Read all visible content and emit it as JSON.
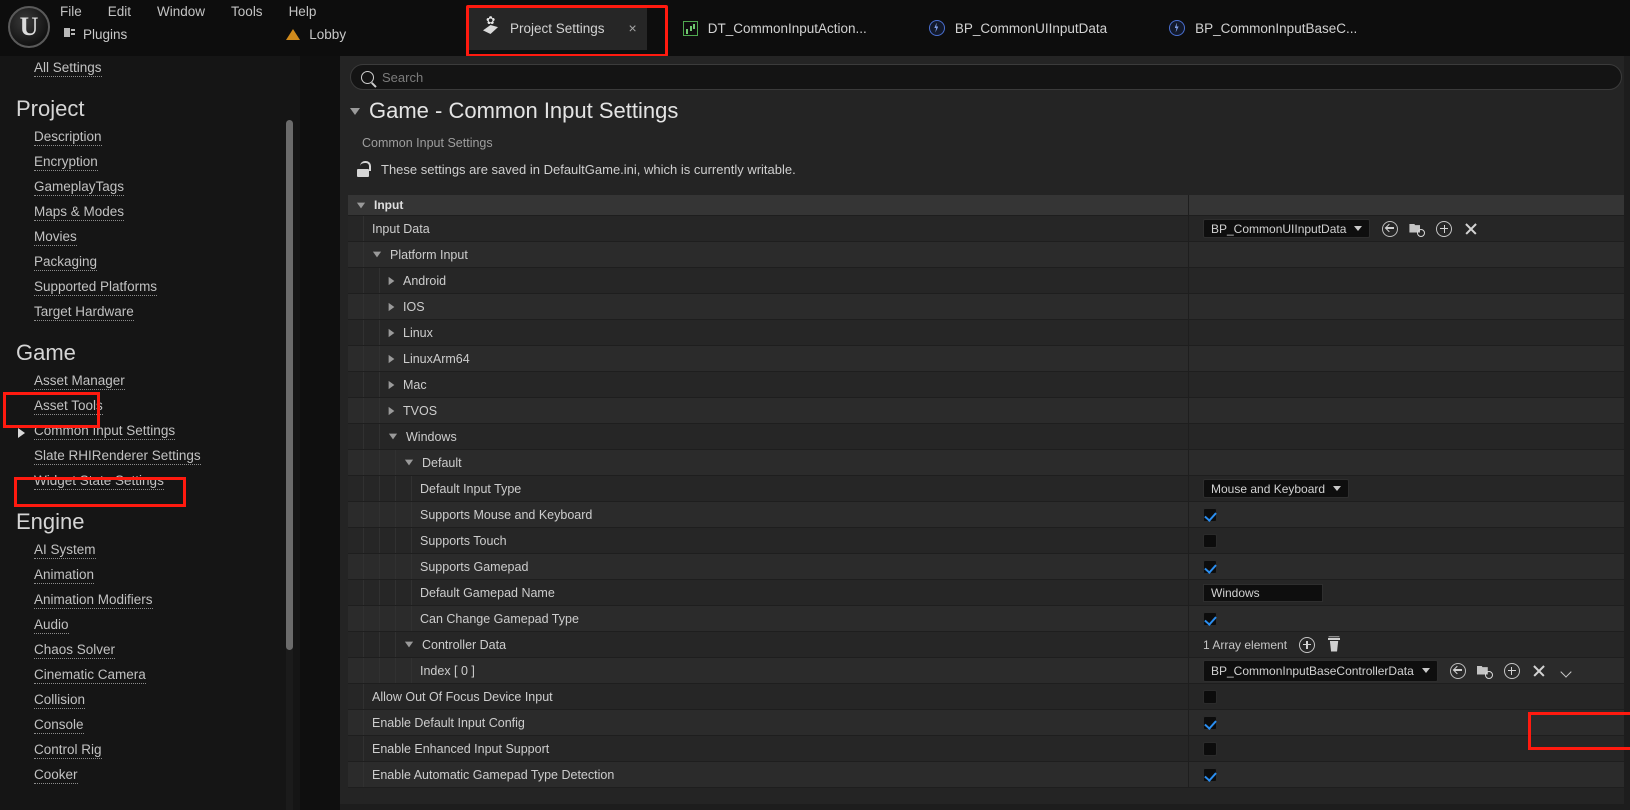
{
  "app": {
    "logo_glyph": "U",
    "menu": [
      "File",
      "Edit",
      "Window",
      "Tools",
      "Help"
    ],
    "toolbar": [
      {
        "label": "Plugins",
        "icon": "plugin-icon"
      },
      {
        "label": "Lobby",
        "icon": "level-icon"
      }
    ]
  },
  "tabs": [
    {
      "label": "Project Settings",
      "icon": "project-settings-icon",
      "active": true,
      "close": "×"
    },
    {
      "label": "DT_CommonInputAction...",
      "icon": "data-table-icon",
      "active": false
    },
    {
      "label": "BP_CommonUIInputData",
      "icon": "blueprint-icon",
      "active": false
    },
    {
      "label": "BP_CommonInputBaseC...",
      "icon": "blueprint-icon",
      "active": false
    }
  ],
  "sidebar": {
    "top_item": "All Settings",
    "sections": [
      {
        "heading": "Project",
        "items": [
          {
            "label": "Description"
          },
          {
            "label": "Encryption"
          },
          {
            "label": "GameplayTags"
          },
          {
            "label": "Maps & Modes"
          },
          {
            "label": "Movies"
          },
          {
            "label": "Packaging"
          },
          {
            "label": "Supported Platforms"
          },
          {
            "label": "Target Hardware"
          }
        ]
      },
      {
        "heading": "Game",
        "items": [
          {
            "label": "Asset Manager"
          },
          {
            "label": "Asset Tools"
          },
          {
            "label": "Common Input Settings",
            "expandable": true,
            "selected": true
          },
          {
            "label": "Slate RHIRenderer Settings"
          },
          {
            "label": "Widget State Settings"
          }
        ]
      },
      {
        "heading": "Engine",
        "items": [
          {
            "label": "AI System"
          },
          {
            "label": "Animation"
          },
          {
            "label": "Animation Modifiers"
          },
          {
            "label": "Audio"
          },
          {
            "label": "Chaos Solver"
          },
          {
            "label": "Cinematic Camera"
          },
          {
            "label": "Collision"
          },
          {
            "label": "Console"
          },
          {
            "label": "Control Rig"
          },
          {
            "label": "Cooker"
          }
        ]
      }
    ]
  },
  "main": {
    "search_placeholder": "Search",
    "search_value": "",
    "page_title": "Game - Common Input Settings",
    "subtitle": "Common Input Settings",
    "lock_note": "These settings are saved in DefaultGame.ini, which is currently writable.",
    "rows": [
      {
        "kind": "category",
        "name": "Input",
        "depth": 0,
        "expanded": true
      },
      {
        "kind": "object",
        "name": "Input Data",
        "depth": 1,
        "value": "BP_CommonUIInputData",
        "actions": [
          "use-selected-icon",
          "browse-icon",
          "new-asset-icon",
          "clear-icon"
        ]
      },
      {
        "kind": "group",
        "name": "Platform Input",
        "depth": 1,
        "expanded": true
      },
      {
        "kind": "group",
        "name": "Android",
        "depth": 2,
        "expanded": false
      },
      {
        "kind": "group",
        "name": "IOS",
        "depth": 2,
        "expanded": false
      },
      {
        "kind": "group",
        "name": "Linux",
        "depth": 2,
        "expanded": false
      },
      {
        "kind": "group",
        "name": "LinuxArm64",
        "depth": 2,
        "expanded": false
      },
      {
        "kind": "group",
        "name": "Mac",
        "depth": 2,
        "expanded": false
      },
      {
        "kind": "group",
        "name": "TVOS",
        "depth": 2,
        "expanded": false
      },
      {
        "kind": "group",
        "name": "Windows",
        "depth": 2,
        "expanded": true
      },
      {
        "kind": "group",
        "name": "Default",
        "depth": 3,
        "expanded": true
      },
      {
        "kind": "enum",
        "name": "Default Input Type",
        "depth": 4,
        "value": "Mouse and Keyboard"
      },
      {
        "kind": "bool",
        "name": "Supports Mouse and Keyboard",
        "depth": 4,
        "value": true
      },
      {
        "kind": "bool",
        "name": "Supports Touch",
        "depth": 4,
        "value": false
      },
      {
        "kind": "bool",
        "name": "Supports Gamepad",
        "depth": 4,
        "value": true
      },
      {
        "kind": "text",
        "name": "Default Gamepad Name",
        "depth": 4,
        "value": "Windows"
      },
      {
        "kind": "bool",
        "name": "Can Change Gamepad Type",
        "depth": 4,
        "value": true
      },
      {
        "kind": "array",
        "name": "Controller Data",
        "depth": 3,
        "expanded": true,
        "value": "1 Array element",
        "actions": [
          "add-element-icon",
          "delete-all-icon"
        ]
      },
      {
        "kind": "object",
        "name": "Index [ 0 ]",
        "depth": 4,
        "value": "BP_CommonInputBaseControllerData",
        "highlighted": true,
        "actions": [
          "use-selected-icon",
          "browse-icon",
          "new-asset-icon",
          "clear-icon",
          "chevron-down-icon"
        ]
      },
      {
        "kind": "bool",
        "name": "Allow Out Of Focus Device Input",
        "depth": 1,
        "value": false
      },
      {
        "kind": "bool",
        "name": "Enable Default Input Config",
        "depth": 1,
        "value": true
      },
      {
        "kind": "bool",
        "name": "Enable Enhanced Input Support",
        "depth": 1,
        "value": false
      },
      {
        "kind": "bool",
        "name": "Enable Automatic Gamepad Type Detection",
        "depth": 1,
        "value": true
      }
    ]
  },
  "highlights": {
    "color": "#ff1a0f",
    "regions": [
      "project-settings-tab",
      "game-section-heading",
      "common-input-settings-item",
      "index-0-object-picker"
    ]
  }
}
